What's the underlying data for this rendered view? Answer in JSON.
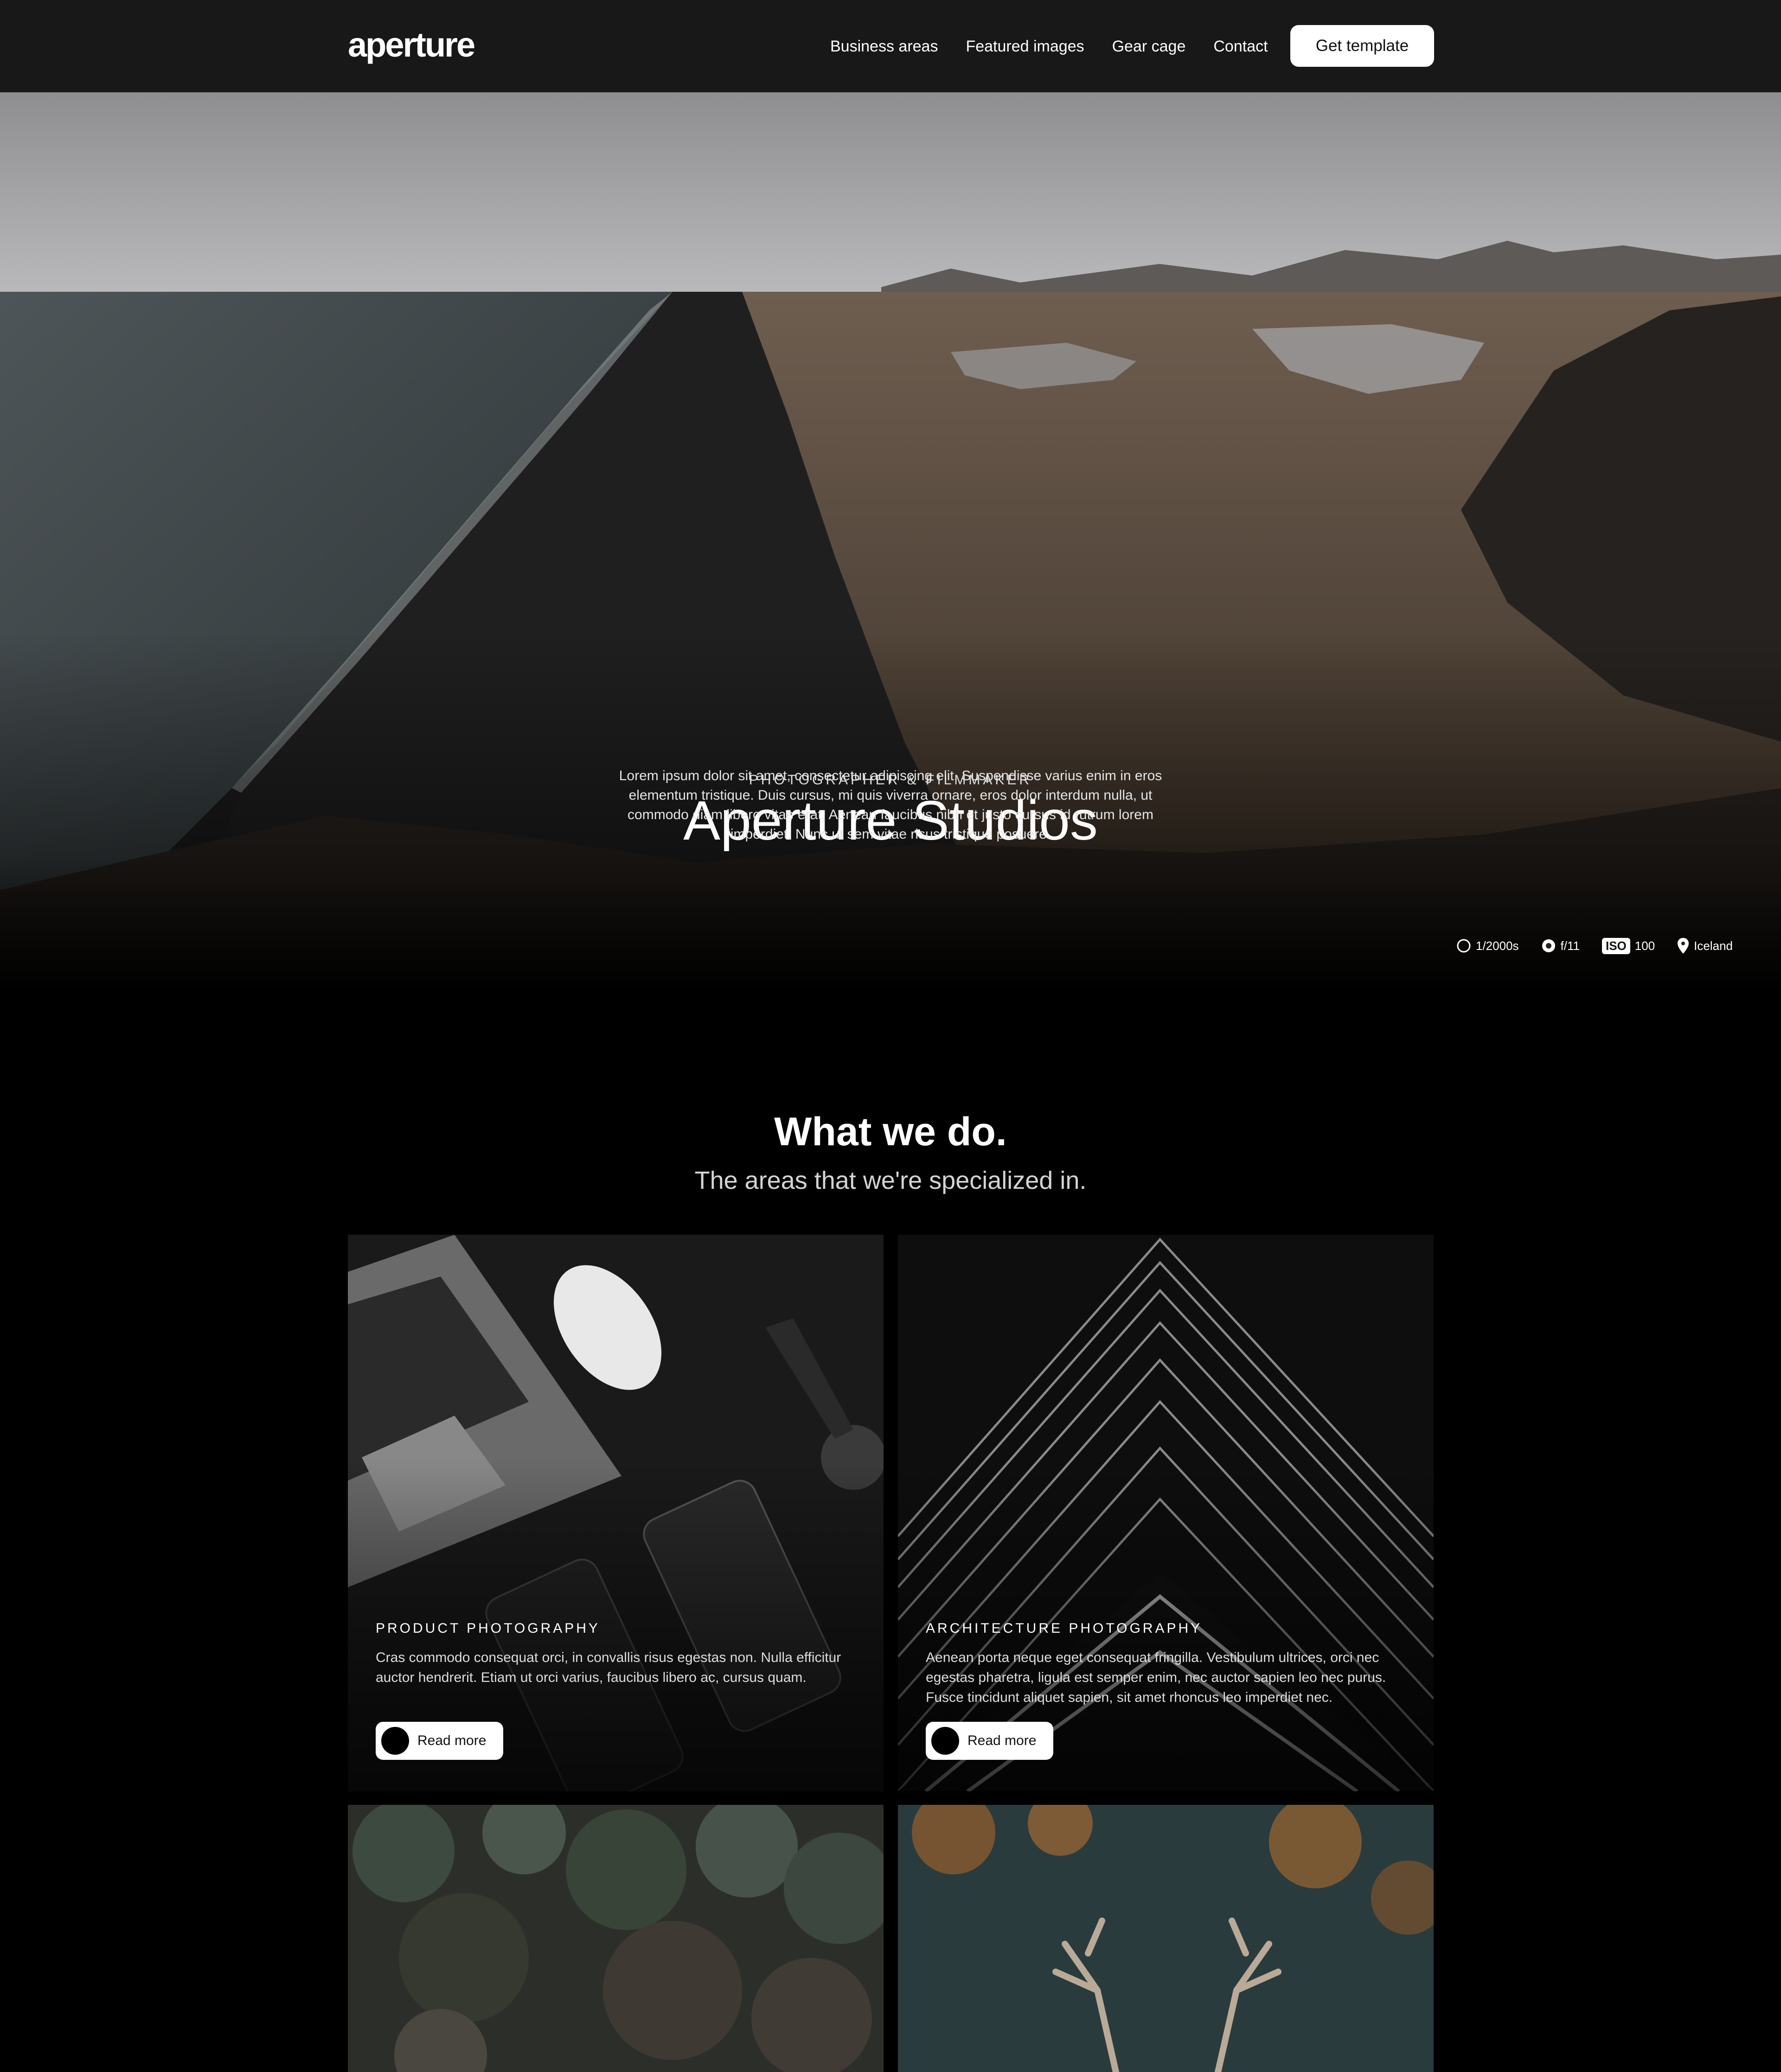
{
  "nav": {
    "logo": "aperture",
    "links": [
      "Business areas",
      "Featured images",
      "Gear cage",
      "Contact"
    ],
    "cta": "Get template"
  },
  "hero": {
    "eyebrow": "PHOTOGRAPHER & FILMMAKER",
    "title": "Aperture Studios",
    "description": "Lorem ipsum dolor sit amet, consectetur adipiscing elit. Suspendisse varius enim in eros elementum tristique. Duis cursus, mi quis viverra ornare, eros dolor interdum nulla, ut commodo diam libero vitae erat. Aenean faucibus nibh et justo cursus id rutrum lorem imperdiet. Nunc ut sem vitae risus tristique posuere.",
    "exif": {
      "shutter": "1/2000s",
      "aperture": "f/11",
      "iso_label": "ISO",
      "iso": "100",
      "location": "Iceland"
    }
  },
  "what_we_do": {
    "title": "What we do.",
    "subtitle": "The areas that we're specialized in.",
    "cards": [
      {
        "label": "PRODUCT PHOTOGRAPHY",
        "text": "Cras commodo consequat orci, in convallis risus egestas non. Nulla efficitur auctor hendrerit. Etiam ut orci varius, faucibus libero ac, cursus quam.",
        "button": "Read more"
      },
      {
        "label": "ARCHITECTURE PHOTOGRAPHY",
        "text": "Aenean porta neque eget consequat fringilla. Vestibulum ultrices, orci nec egestas pharetra, ligula est semper enim, nec auctor sapien leo nec purus. Fusce tincidunt aliquet sapien, sit amet rhoncus leo imperdiet nec.",
        "button": "Read more"
      }
    ]
  }
}
